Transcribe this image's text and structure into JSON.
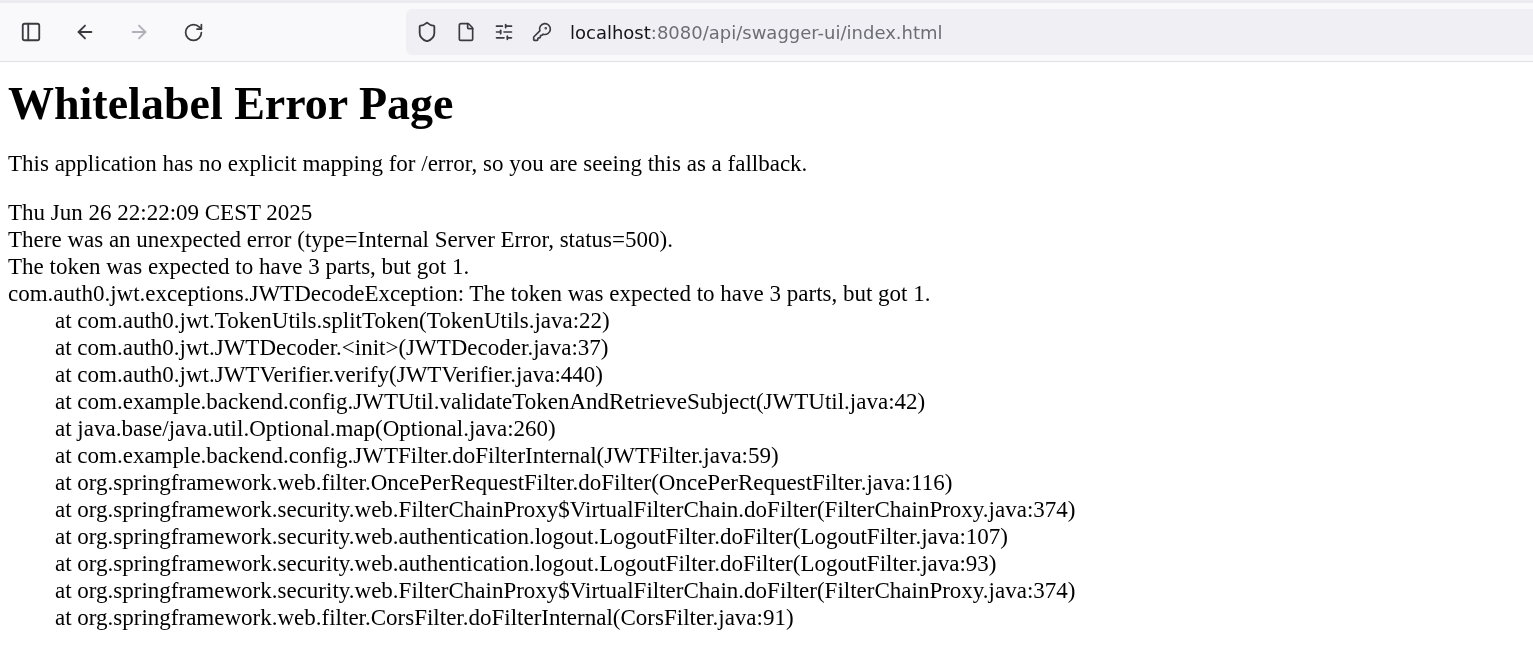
{
  "browser": {
    "back": {
      "disabled": false
    },
    "forward": {
      "disabled": true
    },
    "address": {
      "host": "localhost",
      "rest": ":8080/api/swagger-ui/index.html"
    }
  },
  "page": {
    "title": "Whitelabel Error Page",
    "message": "This application has no explicit mapping for /error, so you are seeing this as a fallback.",
    "details": [
      "Thu Jun 26 22:22:09 CEST 2025",
      "There was an unexpected error (type=Internal Server Error, status=500).",
      "The token was expected to have 3 parts, but got 1.",
      "com.auth0.jwt.exceptions.JWTDecodeException: The token was expected to have 3 parts, but got 1."
    ],
    "stack": [
      "at com.auth0.jwt.TokenUtils.splitToken(TokenUtils.java:22)",
      "at com.auth0.jwt.JWTDecoder.<init>(JWTDecoder.java:37)",
      "at com.auth0.jwt.JWTVerifier.verify(JWTVerifier.java:440)",
      "at com.example.backend.config.JWTUtil.validateTokenAndRetrieveSubject(JWTUtil.java:42)",
      "at java.base/java.util.Optional.map(Optional.java:260)",
      "at com.example.backend.config.JWTFilter.doFilterInternal(JWTFilter.java:59)",
      "at org.springframework.web.filter.OncePerRequestFilter.doFilter(OncePerRequestFilter.java:116)",
      "at org.springframework.security.web.FilterChainProxy$VirtualFilterChain.doFilter(FilterChainProxy.java:374)",
      "at org.springframework.security.web.authentication.logout.LogoutFilter.doFilter(LogoutFilter.java:107)",
      "at org.springframework.security.web.authentication.logout.LogoutFilter.doFilter(LogoutFilter.java:93)",
      "at org.springframework.security.web.FilterChainProxy$VirtualFilterChain.doFilter(FilterChainProxy.java:374)",
      "at org.springframework.web.filter.CorsFilter.doFilterInternal(CorsFilter.java:91)"
    ]
  }
}
